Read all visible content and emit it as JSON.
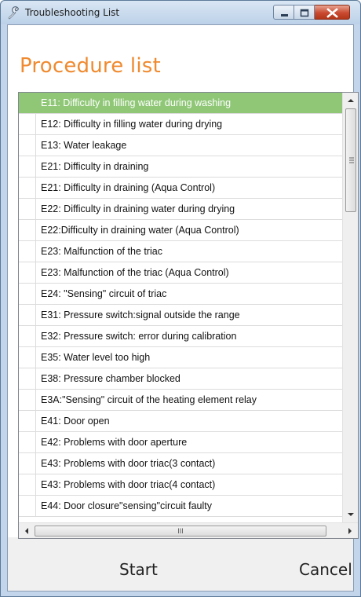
{
  "window": {
    "title": "Troubleshooting List",
    "icons": {
      "app": "wrench-icon",
      "minimize": "minimize-icon",
      "maximize": "maximize-icon",
      "close": "close-icon"
    }
  },
  "heading": "Procedure list",
  "colors": {
    "heading": "#ef8a2f",
    "selected_row": "#8fc777",
    "close_button": "#c94a31"
  },
  "list": {
    "selected_index": 0,
    "items": [
      "E11: Difficulty in filling water during washing",
      "E12: Difficulty in filling water during drying",
      "E13: Water leakage",
      "E21: Difficulty in draining",
      "E21: Difficulty in draining (Aqua Control)",
      "E22: Difficulty in draining water during drying",
      "E22:Difficulty in draining water (Aqua Control)",
      "E23: Malfunction of the triac",
      "E23: Malfunction of the triac (Aqua Control)",
      "E24: \"Sensing\" circuit of triac",
      "E31: Pressure switch:signal outside the range",
      "E32: Pressure switch: error during calibration",
      "E35: Water level too high",
      "E38: Pressure chamber blocked",
      "E3A:\"Sensing\" circuit of the heating element relay",
      "E41: Door open",
      "E42: Problems with door aperture",
      "E43: Problems with door triac(3 contact)",
      "E43: Problems with door triac(4 contact)",
      "E44: Door closure\"sensing\"circuit faulty"
    ],
    "scroll": {
      "vertical_position": 0,
      "grip_label": "III"
    }
  },
  "buttons": {
    "start": "Start",
    "cancel": "Cancel"
  }
}
